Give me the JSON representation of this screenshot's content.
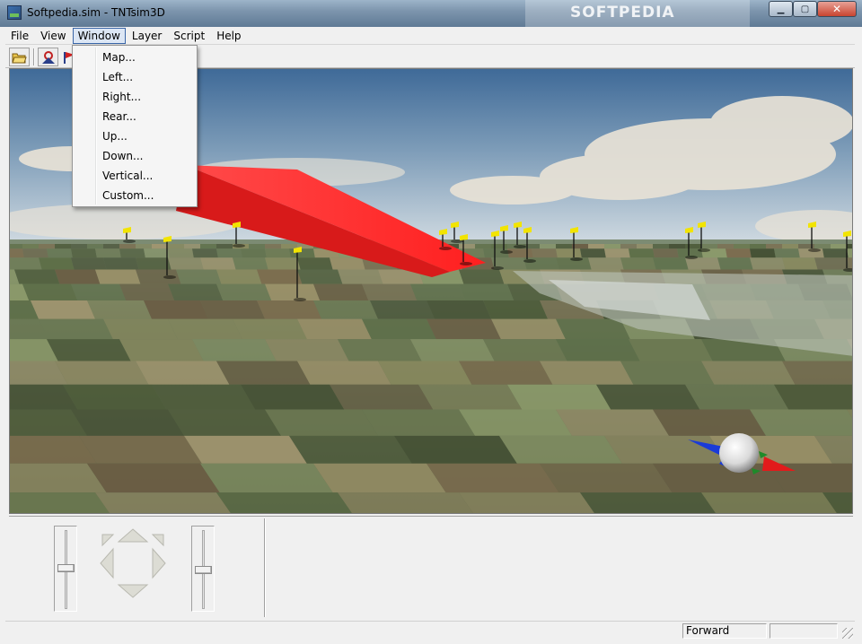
{
  "window": {
    "title": "Softpedia.sim - TNTsim3D",
    "watermark": "SOFTPEDIA"
  },
  "menubar": {
    "items": [
      "File",
      "View",
      "Window",
      "Layer",
      "Script",
      "Help"
    ],
    "active": "Window"
  },
  "window_menu": {
    "items": [
      "Map...",
      "Left...",
      "Right...",
      "Rear...",
      "Up...",
      "Down...",
      "Vertical...",
      "Custom..."
    ]
  },
  "toolbar": {
    "buttons": [
      "open-folder-icon",
      "camera-icon",
      "flag-icon"
    ]
  },
  "statusbar": {
    "direction": "Forward",
    "panel2": ""
  },
  "colors": {
    "sky_top": "#5b7fa8",
    "sky_horizon": "#c9d6e0",
    "ground": "#5f7350",
    "marker_arrow": "#ff2d2d",
    "flag": "#f2e400"
  }
}
